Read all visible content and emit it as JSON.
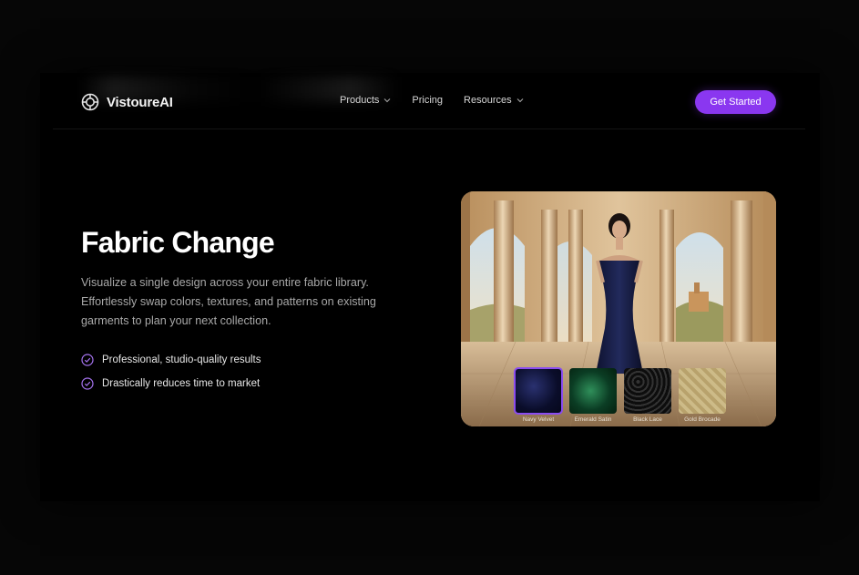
{
  "brand": {
    "name": "VistoureAI",
    "logo_icon": "aperture-icon"
  },
  "nav": {
    "items": [
      {
        "label": "Products",
        "has_dropdown": true
      },
      {
        "label": "Pricing",
        "has_dropdown": false
      },
      {
        "label": "Resources",
        "has_dropdown": true
      }
    ],
    "cta_label": "Get Started"
  },
  "hero": {
    "title": "Fabric Change",
    "description": "Visualize a single design across your entire fabric library. Effortlessly swap colors, textures, and patterns on existing garments to plan your next collection.",
    "features": [
      "Professional, studio-quality results",
      "Drastically reduces time to market"
    ]
  },
  "fabrics": [
    {
      "label": "Navy Velvet",
      "selected": true
    },
    {
      "label": "Emerald Satin",
      "selected": false
    },
    {
      "label": "Black Lace",
      "selected": false
    },
    {
      "label": "Gold Brocade",
      "selected": false
    }
  ],
  "colors": {
    "accent": "#8a37f0",
    "background": "#000000",
    "text_muted": "#a9a9a9"
  }
}
